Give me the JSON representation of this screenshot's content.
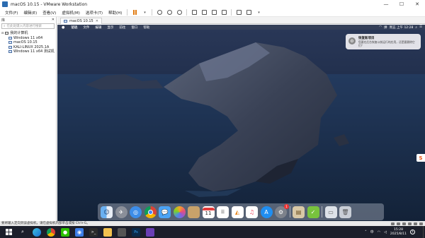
{
  "window": {
    "title": "macOS 10.15 - VMware Workstation",
    "controls": [
      "—",
      "☐",
      "✕"
    ]
  },
  "menu": {
    "items": [
      "文件(F)",
      "编辑(E)",
      "查看(V)",
      "虚拟机(M)",
      "选项卡(T)",
      "帮助(H)"
    ]
  },
  "library": {
    "title": "库",
    "close": "✕",
    "search_placeholder": "在此处键入内容进行搜索",
    "root": "我的计算机",
    "vms": [
      "Windows 11 x64",
      "macOS 10.15",
      "KALI-LINUX 2025.1A",
      "Windows 11 x64 测试机"
    ]
  },
  "vm_tab": {
    "label": "macOS 10.15",
    "close": "✕"
  },
  "mac": {
    "menus": [
      "访达",
      "文件",
      "编辑",
      "显示",
      "前往",
      "窗口",
      "帮助"
    ],
    "clock": "周五 上午 12:28",
    "notification": {
      "title": "恢复新项目",
      "text": "您要在后台恢复以前运行的应用，还是要删除它们？"
    },
    "dock_calendar_day": "11",
    "dock_badge": "1"
  },
  "status_line": {
    "text": "要将输入定向到该虚拟机，请在虚拟机内部单击或按 Ctrl+G。"
  },
  "taskbar": {
    "time": "15:28",
    "date": "2025/8/11",
    "ime": "中",
    "notification_count": "1"
  },
  "colors": {
    "accent_orange": "#e07a10",
    "taskbar_bg": "#1c1f2b",
    "wallpaper_sky": "#1a2740"
  }
}
